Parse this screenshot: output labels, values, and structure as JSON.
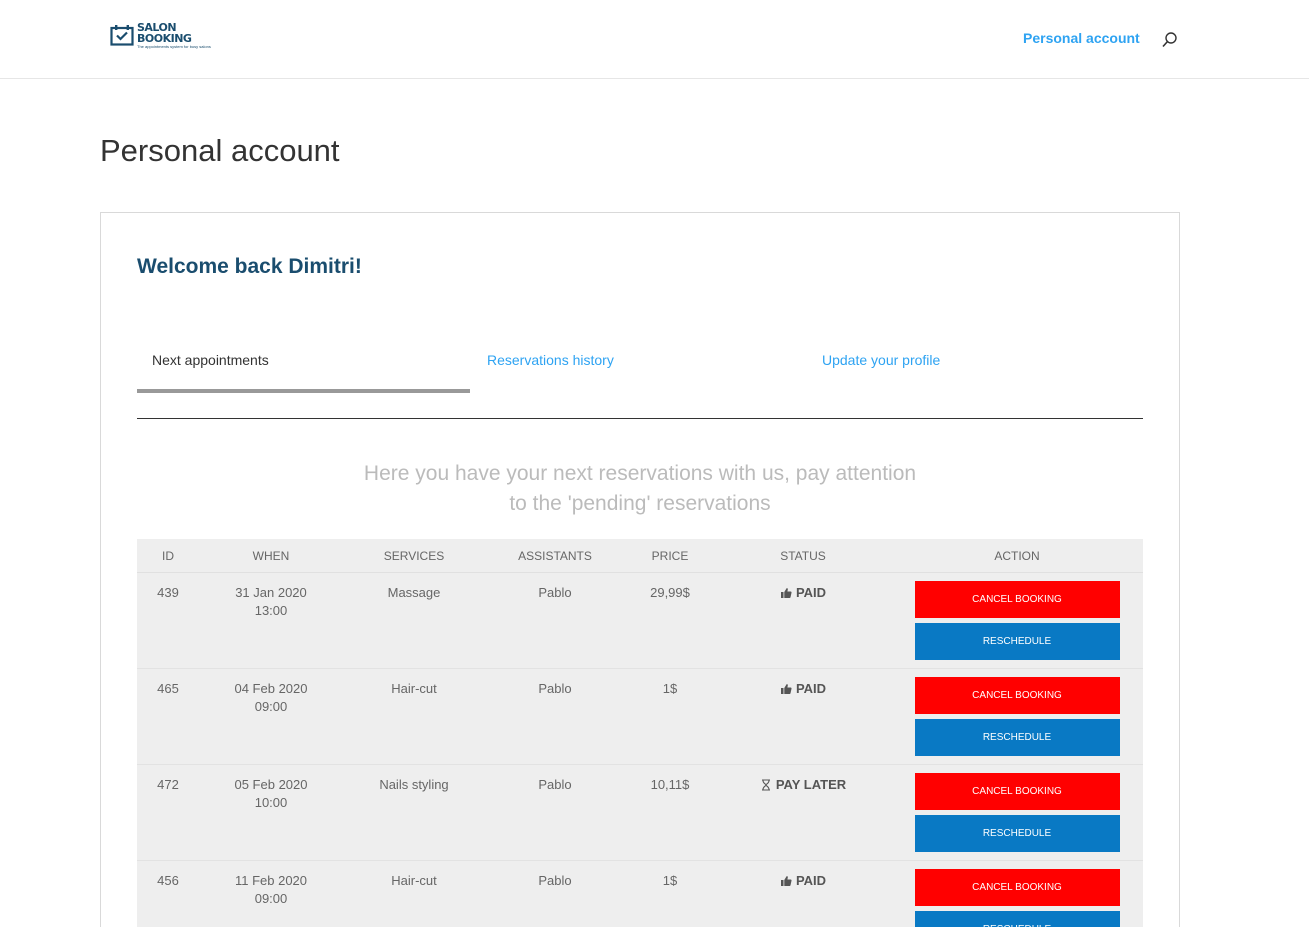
{
  "header": {
    "logo": {
      "line1": "SALON",
      "line2": "BOOKING",
      "tagline": "The appointments system for busy salons"
    },
    "nav_link": "Personal account"
  },
  "page": {
    "title": "Personal account",
    "welcome": "Welcome back Dimitri!",
    "tabs": [
      "Next appointments",
      "Reservations history",
      "Update your profile"
    ],
    "intro_line1": "Here you have your next reservations with us, pay attention",
    "intro_line2": "to the 'pending' reservations"
  },
  "table": {
    "headers": [
      "ID",
      "WHEN",
      "SERVICES",
      "ASSISTANTS",
      "PRICE",
      "STATUS",
      "ACTION"
    ],
    "rows": [
      {
        "id": "439",
        "date": "31 Jan 2020",
        "time": "13:00",
        "service": "Massage",
        "assistant": "Pablo",
        "price": "29,99$",
        "status": "PAID",
        "status_icon": "thumbs-up-icon",
        "cancel": "CANCEL BOOKING",
        "reschedule": "RESCHEDULE"
      },
      {
        "id": "465",
        "date": "04 Feb 2020",
        "time": "09:00",
        "service": "Hair-cut",
        "assistant": "Pablo",
        "price": "1$",
        "status": "PAID",
        "status_icon": "thumbs-up-icon",
        "cancel": "CANCEL BOOKING",
        "reschedule": "RESCHEDULE"
      },
      {
        "id": "472",
        "date": "05 Feb 2020",
        "time": "10:00",
        "service": "Nails styling",
        "assistant": "Pablo",
        "price": "10,11$",
        "status": "PAY LATER",
        "status_icon": "hourglass-icon",
        "cancel": "CANCEL BOOKING",
        "reschedule": "RESCHEDULE"
      },
      {
        "id": "456",
        "date": "11 Feb 2020",
        "time": "09:00",
        "service": "Hair-cut",
        "assistant": "Pablo",
        "price": "1$",
        "status": "PAID",
        "status_icon": "thumbs-up-icon",
        "cancel": "CANCEL BOOKING",
        "reschedule": "RESCHEDULE"
      }
    ]
  },
  "colors": {
    "accent": "#2ea3f2",
    "brand": "#1a4d6e",
    "cancel": "#ff0000",
    "reschedule": "#0979c4"
  }
}
